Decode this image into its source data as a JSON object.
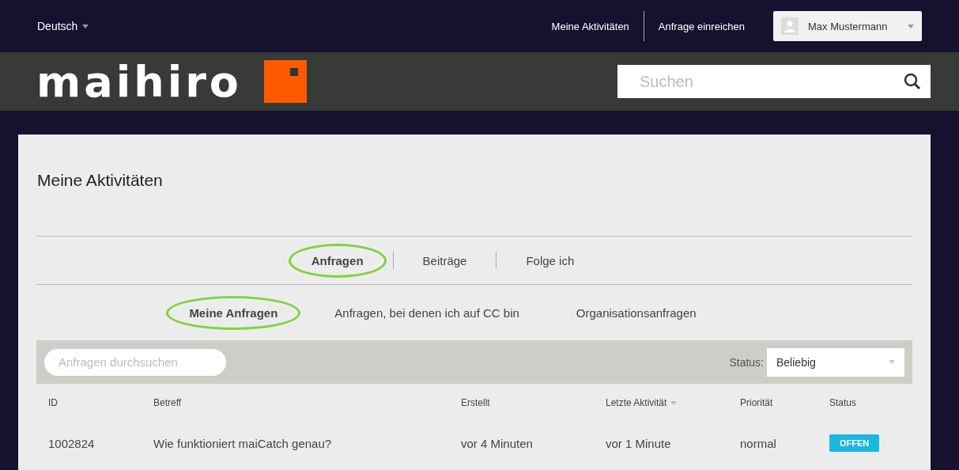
{
  "topbar": {
    "language": "Deutsch",
    "links": [
      "Meine Aktivitäten",
      "Anfrage einreichen"
    ],
    "user": "Max Mustermann"
  },
  "header": {
    "logo": "maihiro",
    "search": {
      "placeholder": "Suchen"
    }
  },
  "page": {
    "title": "Meine Aktivitäten",
    "tabs": [
      {
        "label": "Anfragen",
        "selected": true
      },
      {
        "label": "Beiträge",
        "selected": false
      },
      {
        "label": "Folge ich",
        "selected": false
      }
    ],
    "subtabs": [
      {
        "label": "Meine Anfragen",
        "selected": true
      },
      {
        "label": "Anfragen, bei denen ich auf CC bin",
        "selected": false
      },
      {
        "label": "Organisationsanfragen",
        "selected": false
      }
    ],
    "filter": {
      "search_placeholder": "Anfragen durchsuchen",
      "status_label": "Status:",
      "status_value": "Beliebig"
    },
    "table": {
      "columns": [
        {
          "label": "ID",
          "sorted": false
        },
        {
          "label": "Betreff",
          "sorted": false
        },
        {
          "label": "Erstellt",
          "sorted": false
        },
        {
          "label": "Letzte Aktivität",
          "sorted": true
        },
        {
          "label": "Priorität",
          "sorted": false
        },
        {
          "label": "Status",
          "sorted": false
        }
      ],
      "rows": [
        {
          "id": "1002824",
          "subject": "Wie funktioniert maiCatch genau?",
          "created": "vor 4 Minuten",
          "last_activity": "vor 1 Minute",
          "priority": "normal",
          "status": "OFFEN",
          "color": "#1ab7e0"
        }
      ]
    }
  }
}
